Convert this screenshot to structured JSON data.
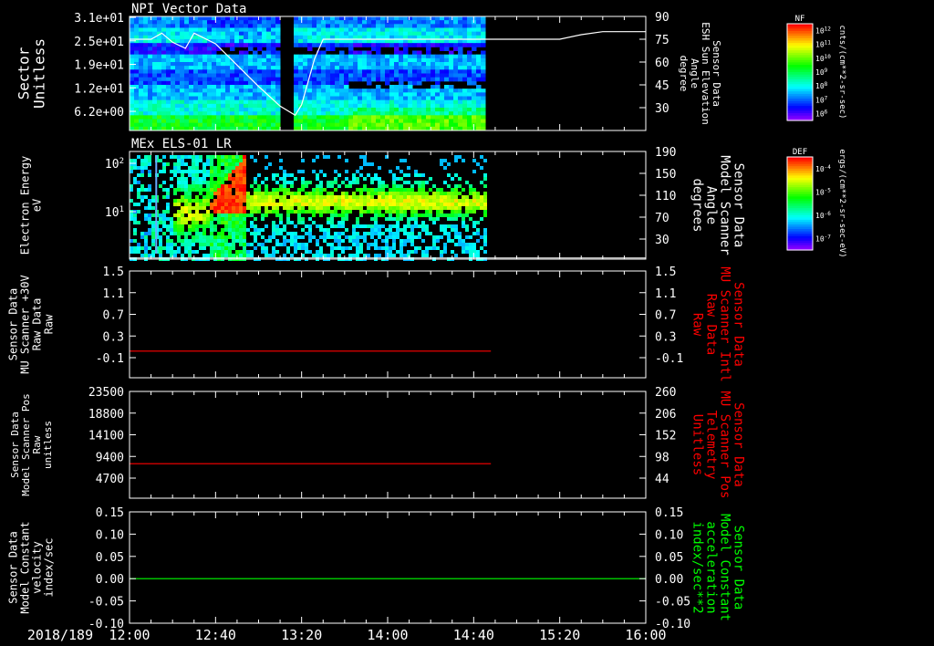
{
  "date_label": "2018/189",
  "time_ticks": [
    "12:00",
    "12:40",
    "13:20",
    "14:00",
    "14:40",
    "15:20",
    "16:00"
  ],
  "colorbars": [
    {
      "key": "NF",
      "unit": "cnts/(cm**2-sr-sec)",
      "tick_labels": [
        "10^12",
        "10^11",
        "10^10",
        "10^9",
        "10^8",
        "10^7",
        "10^6"
      ]
    },
    {
      "key": "DEF",
      "unit": "ergs/(cm**2-sr-sec-eV)",
      "tick_labels": [
        "10^-4",
        "10^-5",
        "10^-6",
        "10^-7"
      ]
    }
  ],
  "chart_data": [
    {
      "type": "heatmap",
      "title": "NPI Vector Data",
      "ylabel": [
        "Sector",
        "Unitless"
      ],
      "yticks": [
        "3.1e+01",
        "2.5e+01",
        "1.9e+01",
        "1.2e+01",
        "6.2e+00"
      ],
      "y2label": [
        "Sensor Data",
        "ESH Sun Elevation",
        "Angle",
        "degree"
      ],
      "y2ticks": [
        "90",
        "75",
        "60",
        "45",
        "30"
      ],
      "y2lim": [
        15,
        90
      ],
      "data_end": "14:44",
      "gap": [
        "13:10",
        "13:16"
      ],
      "overlay_line": {
        "x": [
          "12:00",
          "12:10",
          "12:15",
          "12:20",
          "12:26",
          "12:30",
          "12:40",
          "12:50",
          "13:00",
          "13:10",
          "13:17",
          "13:20",
          "13:26",
          "13:30",
          "13:40",
          "14:00",
          "14:40",
          "15:20",
          "15:30",
          "15:40",
          "16:00"
        ],
        "y": [
          75,
          75,
          79,
          73,
          69,
          79,
          72,
          58,
          44,
          31,
          25,
          32,
          62,
          75,
          75,
          75,
          75,
          75,
          78,
          80,
          80
        ]
      }
    },
    {
      "type": "heatmap",
      "title": "MEx ELS-01 LR",
      "ylabel": [
        "Electron Energy",
        "eV"
      ],
      "yticks": [
        "10^2",
        "10^1"
      ],
      "y2label": [
        "Sensor Data",
        "Model Scanner",
        "Angle",
        "degrees"
      ],
      "y2ticks": [
        "190",
        "150",
        "110",
        "70",
        "30"
      ],
      "y2lim": [
        10,
        190
      ],
      "data_end": "14:46",
      "overlay_line": {
        "x": [
          "12:00",
          "16:00"
        ],
        "y": [
          12,
          12
        ]
      }
    },
    {
      "type": "line",
      "ylabel": [
        "Sensor Data",
        "MU Scanner +30V",
        "Raw Data",
        "Raw"
      ],
      "yticks": [
        "1.5",
        "1.1",
        "0.7",
        "0.3",
        "-0.1"
      ],
      "ylim": [
        -0.5,
        1.5
      ],
      "y2label": [
        "Sensor Data",
        "MU Scanner Intl",
        "Raw Data",
        "Raw"
      ],
      "y2ticks": [
        "1.5",
        "1.1",
        "0.7",
        "0.3",
        "-0.1"
      ],
      "series": [
        {
          "color": "#ff0000",
          "x": [
            "12:00",
            "14:48"
          ],
          "y": [
            0.0,
            0.0
          ]
        }
      ]
    },
    {
      "type": "line",
      "ylabel": [
        "Sensor Data",
        "Model Scanner Pos",
        "Raw",
        "unitless"
      ],
      "yticks": [
        "23500",
        "18800",
        "14100",
        "9400",
        "4700"
      ],
      "ylim": [
        0,
        23500
      ],
      "y2label": [
        "Sensor Data",
        "MU Scanner Pos",
        "Telemetry",
        "Unitless"
      ],
      "y2ticks": [
        "260",
        "206",
        "152",
        "98",
        "44"
      ],
      "series": [
        {
          "color": "#ff0000",
          "x": [
            "12:00",
            "14:48"
          ],
          "y": [
            7600,
            7600
          ]
        }
      ]
    },
    {
      "type": "line",
      "ylabel": [
        "Sensor Data",
        "Model Constant",
        "velocity",
        "index/sec"
      ],
      "yticks": [
        "0.15",
        "0.10",
        "0.05",
        "0.00",
        "-0.05",
        "-0.10"
      ],
      "ylim": [
        -0.1,
        0.15
      ],
      "y2label": [
        "Sensor Data",
        "Model Constant",
        "acceleration",
        "index/sec**2"
      ],
      "y2ticks": [
        "0.15",
        "0.10",
        "0.05",
        "0.00",
        "-0.05",
        "-0.10"
      ],
      "series": [
        {
          "color": "#00ff00",
          "x": [
            "12:00",
            "16:00"
          ],
          "y": [
            0.0,
            0.0
          ]
        }
      ]
    }
  ]
}
